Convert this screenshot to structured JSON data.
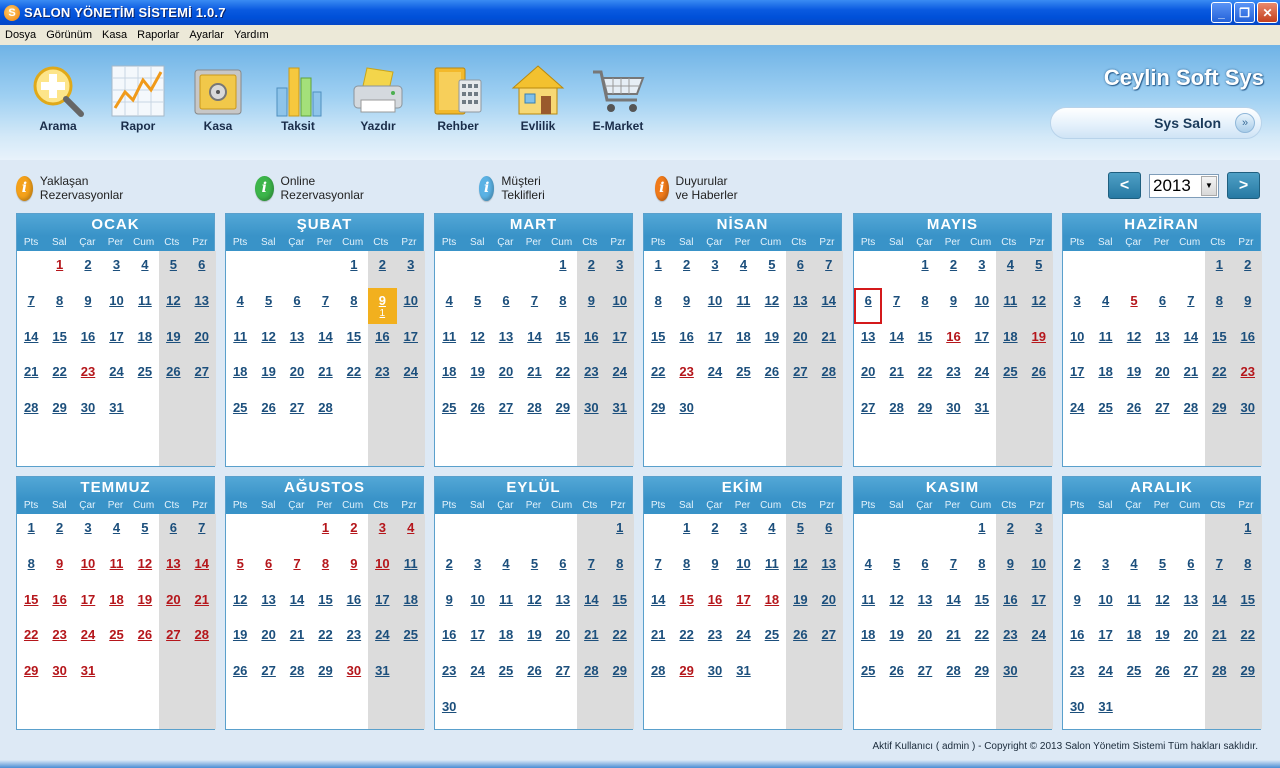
{
  "window": {
    "title": "SALON YÖNETİM SİSTEMİ 1.0.7",
    "app_icon": "S",
    "controls": {
      "minimize": "_",
      "maximize": "❐",
      "close": "✕"
    }
  },
  "menu": [
    "Dosya",
    "Görünüm",
    "Kasa",
    "Raporlar",
    "Ayarlar",
    "Yardım"
  ],
  "toolbar": [
    {
      "label": "Arama",
      "icon": "search-plus-icon"
    },
    {
      "label": "Rapor",
      "icon": "chart-icon"
    },
    {
      "label": "Kasa",
      "icon": "safe-icon"
    },
    {
      "label": "Taksit",
      "icon": "bar-columns-icon"
    },
    {
      "label": "Yazdır",
      "icon": "printer-icon"
    },
    {
      "label": "Rehber",
      "icon": "address-book-icon"
    },
    {
      "label": "Evlilik",
      "icon": "house-icon"
    },
    {
      "label": "E-Market",
      "icon": "shopping-cart-icon"
    }
  ],
  "brand": "Ceylin Soft Sys",
  "salon_selector": {
    "value": "Sys Salon",
    "chevron": "»"
  },
  "info_links": [
    {
      "label": "Yaklaşan Rezervasyonlar",
      "color": "#f4a11a",
      "glyph": "i"
    },
    {
      "label": "Online Rezervasyonlar",
      "color": "#3cb54a",
      "glyph": "i"
    },
    {
      "label": "Müşteri Teklifleri",
      "color": "#5bb2e4",
      "glyph": "i"
    },
    {
      "label": "Duyurular ve Haberler",
      "color": "#f07a1a",
      "glyph": "i"
    }
  ],
  "year_nav": {
    "prev": "<",
    "year": "2013",
    "next": ">",
    "dropdown": "▼"
  },
  "weekday_headers": [
    "Pts",
    "Sal",
    "Çar",
    "Per",
    "Cum",
    "Cts",
    "Pzr"
  ],
  "months": [
    {
      "name": "OCAK",
      "offset": 1,
      "days": 31,
      "holidays": [
        1,
        23
      ]
    },
    {
      "name": "ŞUBAT",
      "offset": 4,
      "days": 28,
      "holidays": [],
      "selected": 9,
      "selected_count": "1"
    },
    {
      "name": "MART",
      "offset": 4,
      "days": 31,
      "holidays": []
    },
    {
      "name": "NİSAN",
      "offset": 0,
      "days": 30,
      "holidays": [
        23
      ]
    },
    {
      "name": "MAYIS",
      "offset": 2,
      "days": 31,
      "holidays": [
        16,
        19
      ],
      "today": 6
    },
    {
      "name": "HAZİRAN",
      "offset": 5,
      "days": 30,
      "holidays": [
        5,
        23
      ]
    },
    {
      "name": "TEMMUZ",
      "offset": 0,
      "days": 31,
      "holidays": [
        9,
        10,
        11,
        12,
        13,
        14,
        15,
        16,
        17,
        18,
        19,
        20,
        21,
        22,
        23,
        24,
        25,
        26,
        27,
        28,
        29,
        30,
        31
      ]
    },
    {
      "name": "AĞUSTOS",
      "offset": 3,
      "days": 31,
      "holidays": [
        1,
        2,
        3,
        4,
        5,
        6,
        7,
        8,
        9,
        10,
        30
      ]
    },
    {
      "name": "EYLÜL",
      "offset": 6,
      "days": 30,
      "holidays": []
    },
    {
      "name": "EKİM",
      "offset": 1,
      "days": 31,
      "holidays": [
        15,
        16,
        17,
        18,
        29
      ]
    },
    {
      "name": "KASIM",
      "offset": 4,
      "days": 30,
      "holidays": []
    },
    {
      "name": "ARALIK",
      "offset": 6,
      "days": 31,
      "holidays": []
    }
  ],
  "footer": "Aktif Kullanıcı ( admin ) - Copyright © 2013 Salon Yönetim Sistemi Tüm hakları saklıdır."
}
